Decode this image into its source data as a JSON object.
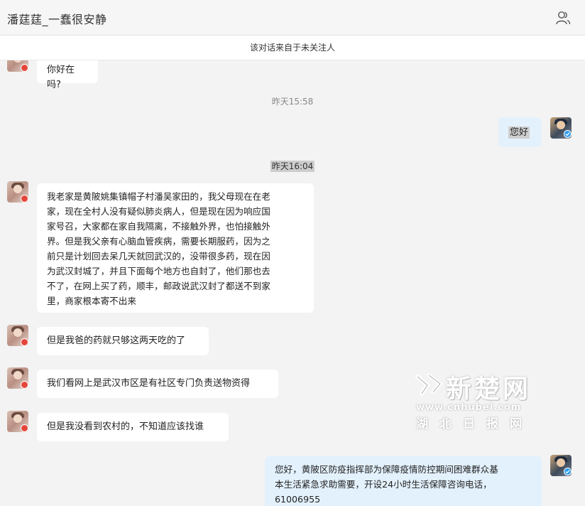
{
  "header": {
    "title": "潘莛莛_一蠢很安静",
    "contact_icon": "user-profile-icon"
  },
  "notice": {
    "text": "该对话来自于未关注人"
  },
  "messages": [
    {
      "direction": "in",
      "text": "你好在吗?"
    },
    {
      "type": "time",
      "text": "昨天15:58"
    },
    {
      "direction": "out",
      "text": "您好"
    },
    {
      "type": "time",
      "text": "昨天16:04"
    },
    {
      "direction": "in",
      "lines": [
        "我老家是黄陂姚集镇帽子村潘吴家田的，我父母现在在老",
        "家，现在全村人没有疑似肺炎病人，但是现在因为响应国",
        "家号召，大家都在家自我隔离，不接触外界，也怕接触外",
        "界。但是我父亲有心脑血管疾病，需要长期服药，因为之",
        "前只是计划回去呆几天就回武汉的，没带很多药，现在因",
        "为武汉封城了，并且下面每个地方也自封了，他们那也去",
        "不了，在网上买了药，顺丰，邮政说武汉封了都送不到家",
        "里，商家根本寄不出来"
      ]
    },
    {
      "direction": "in",
      "text": "但是我爸的药就只够这两天吃的了"
    },
    {
      "direction": "in",
      "text": "我们看网上是武汉市区是有社区专门负责送物资得"
    },
    {
      "direction": "in",
      "text": "但是我没看到农村的，不知道应该找谁"
    },
    {
      "direction": "out",
      "lines": [
        "您好，黄陂区防疫指挥部为保障疫情防控期间困难群众基",
        "本生活紧急求助需要，开设24小时生活保障咨询电话，",
        "61006955"
      ]
    }
  ],
  "watermark": {
    "main": "新楚网",
    "url": "www.cnhubei.com",
    "sub": "湖北日报网"
  }
}
